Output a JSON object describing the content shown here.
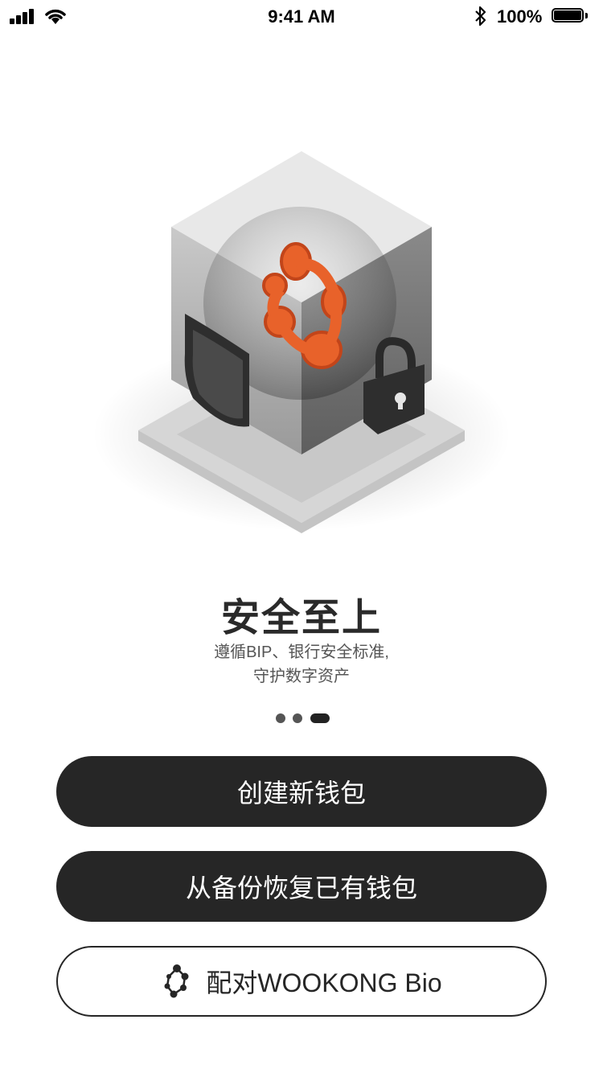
{
  "status_bar": {
    "time": "9:41 AM",
    "battery_percent": "100%",
    "battery_level": 1.0,
    "signal_icon": "cellular-signal-icon",
    "wifi_icon": "wifi-icon",
    "bluetooth_icon": "bluetooth-icon"
  },
  "onboarding": {
    "title": "安全至上",
    "subtitle_line1": "遵循BIP、银行安全标准,",
    "subtitle_line2": "守护数字资产",
    "pages_total": 3,
    "current_page": 3
  },
  "actions": {
    "create_wallet": "创建新钱包",
    "restore_wallet": "从备份恢复已有钱包",
    "pair_device": "配对WOOKONG Bio"
  },
  "colors": {
    "accent": "#262626",
    "logo_orange": "#E8622A",
    "text_muted": "#555555"
  }
}
